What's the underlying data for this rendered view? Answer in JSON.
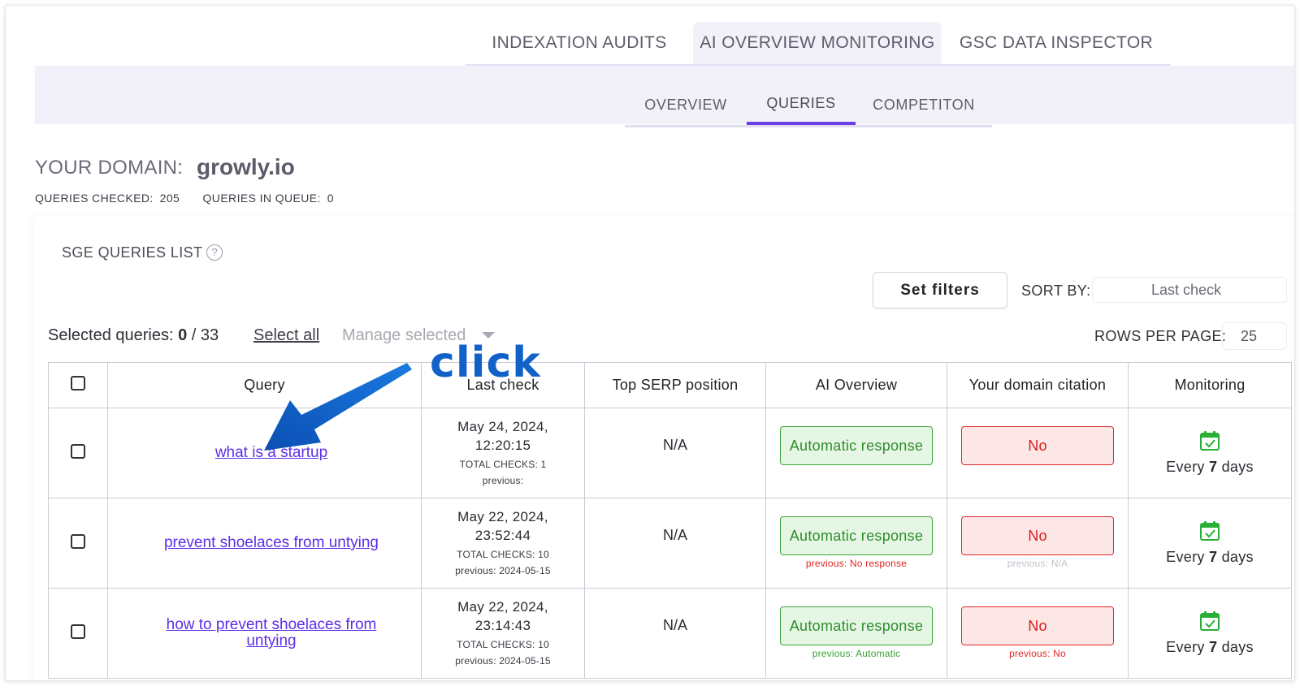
{
  "main_tabs": [
    {
      "label": "INDEXATION AUDITS"
    },
    {
      "label": "AI OVERVIEW MONITORING"
    },
    {
      "label": "GSC DATA INSPECTOR"
    }
  ],
  "sub_tabs": [
    {
      "label": "OVERVIEW"
    },
    {
      "label": "QUERIES"
    },
    {
      "label": "COMPETITON"
    }
  ],
  "domain": {
    "label": "YOUR DOMAIN:",
    "value": "growly.io"
  },
  "stats": {
    "checked_label": "QUERIES CHECKED:",
    "checked_value": "205",
    "queue_label": "QUERIES IN QUEUE:",
    "queue_value": "0"
  },
  "list": {
    "title": "SGE QUERIES LIST",
    "help_icon": "?",
    "filters_label": "Set filters",
    "sort_label": "SORT BY:",
    "sort_value": "Last check",
    "selected_label": "Selected queries:",
    "selected_count": "0",
    "selected_total": "/ 33",
    "select_all": "Select all",
    "manage_selected": "Manage selected",
    "rows_label": "ROWS PER PAGE:",
    "rows_value": "25"
  },
  "table": {
    "headers": {
      "query": "Query",
      "last_check": "Last check",
      "top_serp": "Top SERP position",
      "ai_overview": "AI Overview",
      "citation": "Your domain citation",
      "monitoring": "Monitoring"
    },
    "rows": [
      {
        "query": "what is a startup",
        "date": "May 24, 2024,",
        "time": "12:20:15",
        "total_checks": "TOTAL CHECKS: 1",
        "previous": "previous:",
        "serp": "N/A",
        "ai_overview": "Automatic response",
        "ai_prev": "",
        "citation": "No",
        "citation_prev": "",
        "monitor_prefix": "Every",
        "monitor_num": "7",
        "monitor_suffix": "days"
      },
      {
        "query": "prevent shoelaces from untying",
        "date": "May 22, 2024,",
        "time": "23:52:44",
        "total_checks": "TOTAL CHECKS: 10",
        "previous": "previous: 2024-05-15",
        "serp": "N/A",
        "ai_overview": "Automatic response",
        "ai_prev": "previous: No response",
        "citation": "No",
        "citation_prev": "previous: N/A",
        "monitor_prefix": "Every",
        "monitor_num": "7",
        "monitor_suffix": "days"
      },
      {
        "query": "how to prevent shoelaces from untying",
        "date": "May 22, 2024,",
        "time": "23:14:43",
        "total_checks": "TOTAL CHECKS: 10",
        "previous": "previous: 2024-05-15",
        "serp": "N/A",
        "ai_overview": "Automatic response",
        "ai_prev": "previous: Automatic",
        "citation": "No",
        "citation_prev": "previous: No",
        "monitor_prefix": "Every",
        "monitor_num": "7",
        "monitor_suffix": "days"
      }
    ]
  },
  "annotation": {
    "text": "click"
  },
  "colors": {
    "accent": "#6a3fe4",
    "link": "#5b2ee8",
    "green": "#3da53a",
    "red": "#e02a2a",
    "annotation": "#1161c9"
  },
  "icons": {
    "monitoring": "calendar-check-icon",
    "help": "question-circle-icon",
    "caret": "caret-down-icon"
  }
}
